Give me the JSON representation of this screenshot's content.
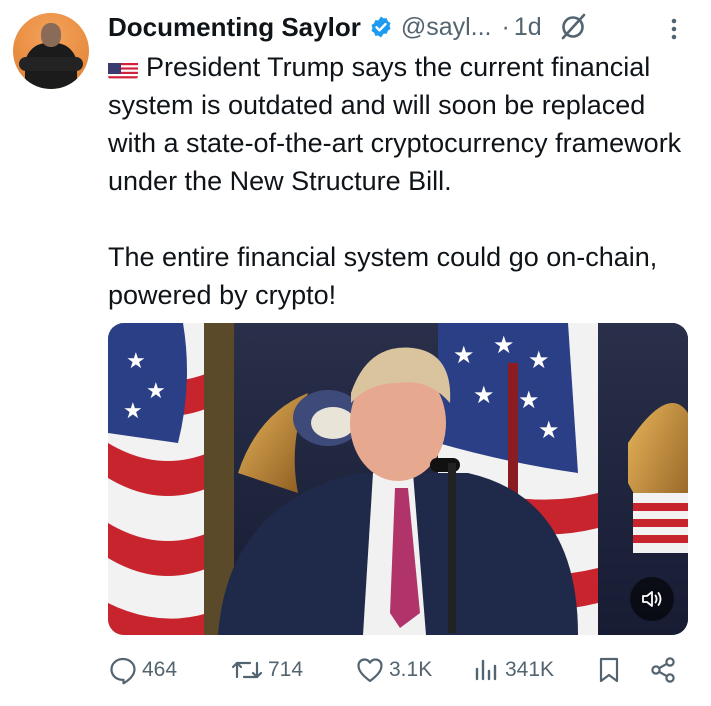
{
  "tweet": {
    "author_name": "Documenting Saylor",
    "handle": "@sayl...",
    "separator": "·",
    "time": "1d",
    "paragraph1": "President Trump says the current financial system is outdated and will soon be replaced with a state-of-the-art cryptocurrency framework under the New Structure Bill.",
    "paragraph2": "The entire financial system could go on-chain, powered by crypto!",
    "flag_icon": "us-flag-icon"
  },
  "media": {
    "type": "video",
    "mute_icon": "speaker-icon"
  },
  "actions": {
    "replies": "464",
    "reposts": "714",
    "likes": "3.1K",
    "views": "341K",
    "bookmark_icon": "bookmark-icon",
    "share_icon": "share-icon"
  },
  "colors": {
    "text": "#0f1419",
    "muted": "#536471",
    "verified": "#1d9bf0"
  }
}
